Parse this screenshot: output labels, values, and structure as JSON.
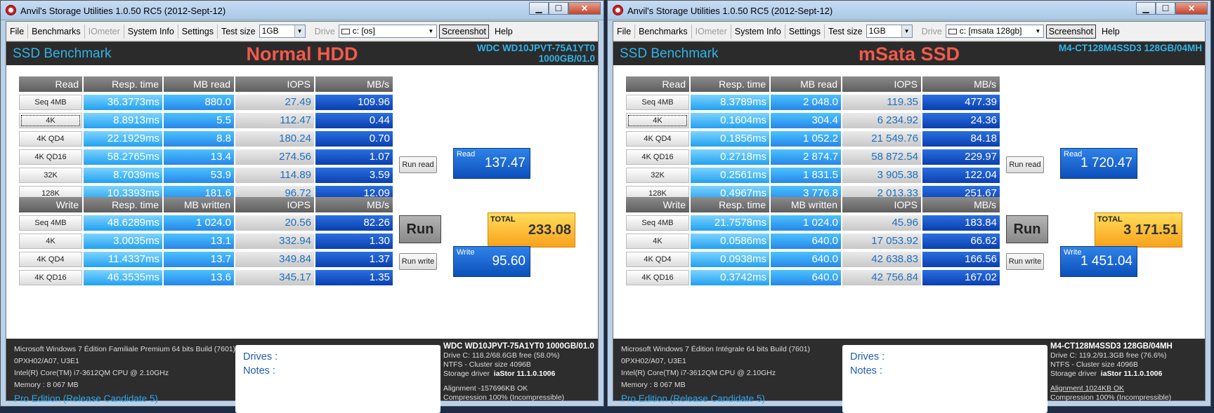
{
  "windows": [
    {
      "title": "Anvil's Storage Utilities 1.0.50 RC5 (2012-Sept-12)",
      "menu": {
        "file": "File",
        "benchmarks": "Benchmarks",
        "iometer": "IOmeter",
        "system_info": "System Info",
        "settings": "Settings",
        "test_size_label": "Test size",
        "test_size_value": "1GB",
        "drive_label": "Drive",
        "drive_value": "c: [os]",
        "screenshot": "Screenshot",
        "help": "Help"
      },
      "header": {
        "left": "SSD Benchmark",
        "mid": "Normal HDD",
        "right1": "WDC WD10JPVT-75A1YT0",
        "right2": "1000GB/01.0"
      },
      "read": {
        "headers": [
          "Read",
          "Resp. time",
          "MB read",
          "IOPS",
          "MB/s"
        ],
        "rows": [
          [
            "Seq 4MB",
            "36.3773ms",
            "880.0",
            "27.49",
            "109.96"
          ],
          [
            "4K",
            "8.8913ms",
            "5.5",
            "112.47",
            "0.44"
          ],
          [
            "4K QD4",
            "22.1929ms",
            "8.8",
            "180.24",
            "0.70"
          ],
          [
            "4K QD16",
            "58.2765ms",
            "13.4",
            "274.56",
            "1.07"
          ],
          [
            "32K",
            "8.7039ms",
            "53.9",
            "114.89",
            "3.59"
          ],
          [
            "128K",
            "10.3393ms",
            "181.6",
            "96.72",
            "12.09"
          ]
        ]
      },
      "write": {
        "headers": [
          "Write",
          "Resp. time",
          "MB written",
          "IOPS",
          "MB/s"
        ],
        "rows": [
          [
            "Seq 4MB",
            "48.6289ms",
            "1 024.0",
            "20.56",
            "82.26"
          ],
          [
            "4K",
            "3.0035ms",
            "13.1",
            "332.94",
            "1.30"
          ],
          [
            "4K QD4",
            "11.4337ms",
            "13.7",
            "349.84",
            "1.37"
          ],
          [
            "4K QD16",
            "46.3535ms",
            "13.6",
            "345.17",
            "1.35"
          ]
        ]
      },
      "run_read": "Run read",
      "run": "Run",
      "run_write": "Run write",
      "read_box": {
        "label": "Read",
        "value": "137.47"
      },
      "total_box": {
        "label": "TOTAL",
        "value": "233.08"
      },
      "write_box": {
        "label": "Write",
        "value": "95.60"
      },
      "sys": [
        "Microsoft Windows 7 Édition Familiale Premium  64 bits Build (7601)",
        "0PXH02/A07, U3E1",
        "Intel(R) Core(TM) i7-3612QM CPU @ 2.10GHz",
        "Memory : 8 067 MB"
      ],
      "pro": "Pro Edition (Release Candidate 5)",
      "notes": {
        "drives": "Drives :",
        "notes": "Notes :"
      },
      "drv": {
        "title": "WDC WD10JPVT-75A1YT0 1000GB/01.0",
        "l1": "Drive C: 118.2/68.6GB free (58.0%)",
        "l2": "NTFS - Cluster size 4096B",
        "l3_label": "Storage driver",
        "l3_value": "iaStor 11.1.0.1006",
        "l4": "Alignment -157696KB OK",
        "l5": "Compression 100% (Incompressible)"
      }
    },
    {
      "title": "Anvil's Storage Utilities 1.0.50 RC5 (2012-Sept-12)",
      "menu": {
        "file": "File",
        "benchmarks": "Benchmarks",
        "iometer": "IOmeter",
        "system_info": "System Info",
        "settings": "Settings",
        "test_size_label": "Test size",
        "test_size_value": "1GB",
        "drive_label": "Drive",
        "drive_value": "c: [msata 128gb]",
        "screenshot": "Screenshot",
        "help": "Help"
      },
      "header": {
        "left": "SSD Benchmark",
        "mid": "mSata SSD",
        "right1": "M4-CT128M4SSD3 128GB/04MH",
        "right2": ""
      },
      "read": {
        "headers": [
          "Read",
          "Resp. time",
          "MB read",
          "IOPS",
          "MB/s"
        ],
        "rows": [
          [
            "Seq 4MB",
            "8.3789ms",
            "2 048.0",
            "119.35",
            "477.39"
          ],
          [
            "4K",
            "0.1604ms",
            "304.4",
            "6 234.92",
            "24.36"
          ],
          [
            "4K QD4",
            "0.1856ms",
            "1 052.2",
            "21 549.76",
            "84.18"
          ],
          [
            "4K QD16",
            "0.2718ms",
            "2 874.7",
            "58 872.54",
            "229.97"
          ],
          [
            "32K",
            "0.2561ms",
            "1 831.5",
            "3 905.38",
            "122.04"
          ],
          [
            "128K",
            "0.4967ms",
            "3 776.8",
            "2 013.33",
            "251.67"
          ]
        ]
      },
      "write": {
        "headers": [
          "Write",
          "Resp. time",
          "MB written",
          "IOPS",
          "MB/s"
        ],
        "rows": [
          [
            "Seq 4MB",
            "21.7578ms",
            "1 024.0",
            "45.96",
            "183.84"
          ],
          [
            "4K",
            "0.0586ms",
            "640.0",
            "17 053.92",
            "66.62"
          ],
          [
            "4K QD4",
            "0.0938ms",
            "640.0",
            "42 638.83",
            "166.56"
          ],
          [
            "4K QD16",
            "0.3742ms",
            "640.0",
            "42 756.84",
            "167.02"
          ]
        ]
      },
      "run_read": "Run read",
      "run": "Run",
      "run_write": "Run write",
      "read_box": {
        "label": "Read",
        "value": "1 720.47"
      },
      "total_box": {
        "label": "TOTAL",
        "value": "3 171.51"
      },
      "write_box": {
        "label": "Write",
        "value": "1 451.04"
      },
      "sys": [
        "Microsoft Windows 7 Édition Intégrale  64 bits Build (7601)",
        "0PXH02/A07, U3E1",
        "Intel(R) Core(TM) i7-3612QM CPU @ 2.10GHz",
        "Memory : 8 067 MB"
      ],
      "pro": "Pro Edition (Release Candidate 5)",
      "notes": {
        "drives": "Drives :",
        "notes": "Notes :"
      },
      "drv": {
        "title": "M4-CT128M4SSD3 128GB/04MH",
        "l1": "Drive C: 119.2/91.3GB free (76.6%)",
        "l2": "NTFS - Cluster size 4096B",
        "l3_label": "Storage driver",
        "l3_value": "iaStor 11.1.0.1006",
        "l4": "Alignment 1024KB OK",
        "l5": "Compression 100% (Incompressible)"
      }
    }
  ],
  "window_buttons": {
    "minimize": "▁",
    "maximize": "☐",
    "close": "✕"
  }
}
